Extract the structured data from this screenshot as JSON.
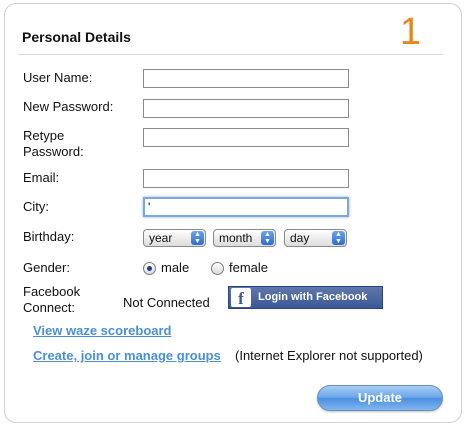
{
  "section": {
    "title": "Personal Details",
    "step_number": "1"
  },
  "form": {
    "username": {
      "label": "User Name:",
      "value": ""
    },
    "new_password": {
      "label": "New Password:",
      "value": ""
    },
    "retype_password": {
      "label_line1": "Retype",
      "label_line2": "Password:",
      "value": ""
    },
    "email": {
      "label": "Email:",
      "value": ""
    },
    "city": {
      "label": "City:",
      "value": "'"
    },
    "birthday": {
      "label": "Birthday:",
      "year": "year",
      "month": "month",
      "day": "day"
    },
    "gender": {
      "label": "Gender:",
      "options": [
        "male",
        "female"
      ],
      "selected": "male"
    },
    "facebook": {
      "label_line1": "Facebook",
      "label_line2": "Connect:",
      "status": "Not Connected",
      "button_label": "Login with Facebook",
      "icon_letter": "f"
    }
  },
  "links": {
    "scoreboard": "View waze scoreboard",
    "groups": "Create, join or manage groups",
    "groups_note": "(Internet Explorer not supported)"
  },
  "actions": {
    "update_label": "Update"
  },
  "colors": {
    "accent_orange": "#e8841c",
    "link_blue": "#4a8fd8",
    "facebook_blue": "#3b5998",
    "button_blue": "#6aa6ea"
  }
}
